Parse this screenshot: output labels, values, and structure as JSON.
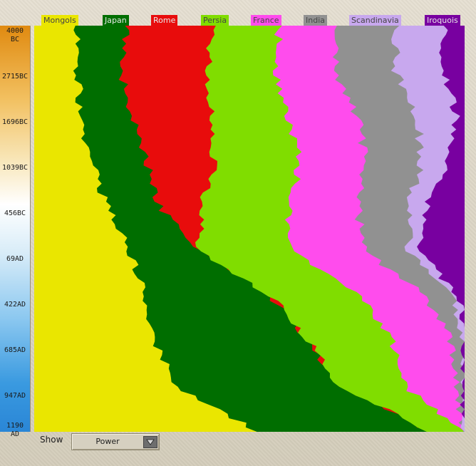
{
  "chart_data": {
    "type": "area",
    "title": "",
    "xlabel": "",
    "ylabel": "",
    "time_ticks": [
      "4000 BC",
      "2715BC",
      "1696BC",
      "1039BC",
      "456BC",
      "69AD",
      "422AD",
      "685AD",
      "947AD",
      "1190 AD"
    ],
    "legend": [
      {
        "name": "Mongols",
        "color": "#eae600"
      },
      {
        "name": "Japan",
        "color": "#006e00"
      },
      {
        "name": "Rome",
        "color": "#e80c0c"
      },
      {
        "name": "Persia",
        "color": "#80dd00"
      },
      {
        "name": "France",
        "color": "#ff4ced"
      },
      {
        "name": "India",
        "color": "#919191"
      },
      {
        "name": "Scandinavia",
        "color": "#c8a8ee"
      },
      {
        "name": "Iroquois",
        "color": "#7800a0"
      }
    ],
    "series": [
      {
        "name": "Mongols",
        "values": [
          0.1,
          0.1,
          0.11,
          0.13,
          0.17,
          0.22,
          0.26,
          0.28,
          0.33,
          0.52
        ]
      },
      {
        "name": "Japan",
        "values": [
          0.12,
          0.1,
          0.12,
          0.13,
          0.12,
          0.16,
          0.29,
          0.36,
          0.38,
          0.4
        ]
      },
      {
        "name": "Rome",
        "values": [
          0.2,
          0.2,
          0.18,
          0.16,
          0.1,
          0.0,
          0.0,
          0.0,
          0.0,
          0.0
        ]
      },
      {
        "name": "Persia",
        "values": [
          0.15,
          0.16,
          0.18,
          0.2,
          0.2,
          0.22,
          0.21,
          0.19,
          0.15,
          0.08
        ]
      },
      {
        "name": "France",
        "values": [
          0.13,
          0.14,
          0.16,
          0.15,
          0.16,
          0.17,
          0.15,
          0.14,
          0.12,
          0.0
        ]
      },
      {
        "name": "India",
        "values": [
          0.14,
          0.14,
          0.14,
          0.13,
          0.12,
          0.1,
          0.06,
          0.03,
          0.02,
          0.0
        ]
      },
      {
        "name": "Scandinavia",
        "values": [
          0.11,
          0.11,
          0.09,
          0.06,
          0.04,
          0.02,
          0.02,
          0.0,
          0.0,
          0.0
        ]
      },
      {
        "name": "Iroquois",
        "values": [
          0.05,
          0.05,
          0.02,
          0.04,
          0.09,
          0.11,
          0.01,
          0.0,
          0.0,
          0.0
        ]
      }
    ]
  },
  "controls": {
    "show_label": "Show",
    "show_value": "Power"
  },
  "icons": {
    "dropdown": "triangle-down-icon"
  }
}
